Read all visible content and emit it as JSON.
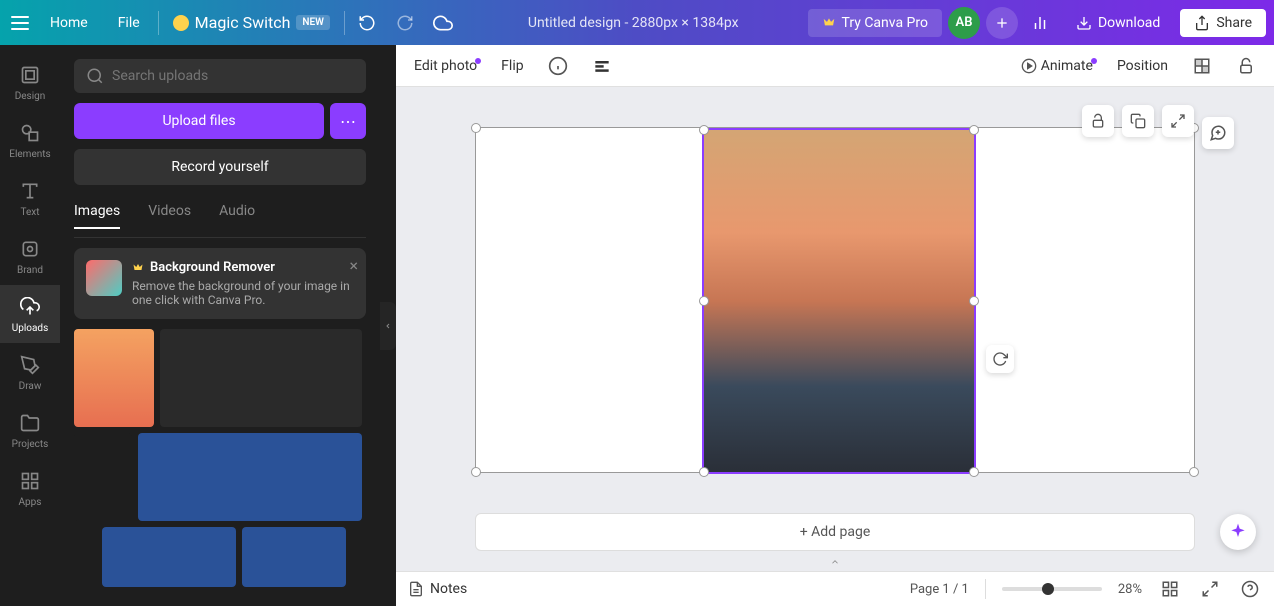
{
  "header": {
    "home": "Home",
    "file": "File",
    "magic_switch": "Magic Switch",
    "new_badge": "NEW",
    "design_title": "Untitled design - 2880px × 1384px",
    "try_pro": "Try Canva Pro",
    "avatar_initials": "AB",
    "download": "Download",
    "share": "Share"
  },
  "sidebar": {
    "items": [
      {
        "label": "Design"
      },
      {
        "label": "Elements"
      },
      {
        "label": "Text"
      },
      {
        "label": "Brand"
      },
      {
        "label": "Uploads"
      },
      {
        "label": "Draw"
      },
      {
        "label": "Projects"
      },
      {
        "label": "Apps"
      }
    ]
  },
  "uploads_panel": {
    "search_placeholder": "Search uploads",
    "upload_label": "Upload files",
    "record_label": "Record yourself",
    "tabs": [
      {
        "label": "Images",
        "active": true
      },
      {
        "label": "Videos",
        "active": false
      },
      {
        "label": "Audio",
        "active": false
      }
    ],
    "bg_remover": {
      "title": "Background Remover",
      "desc": "Remove the background of your image in one click with Canva Pro."
    }
  },
  "canvas_toolbar": {
    "edit_photo": "Edit photo",
    "flip": "Flip",
    "animate": "Animate",
    "position": "Position"
  },
  "add_page": "+ Add page",
  "bottom_bar": {
    "notes": "Notes",
    "page_info": "Page 1 / 1",
    "zoom": "28%"
  }
}
